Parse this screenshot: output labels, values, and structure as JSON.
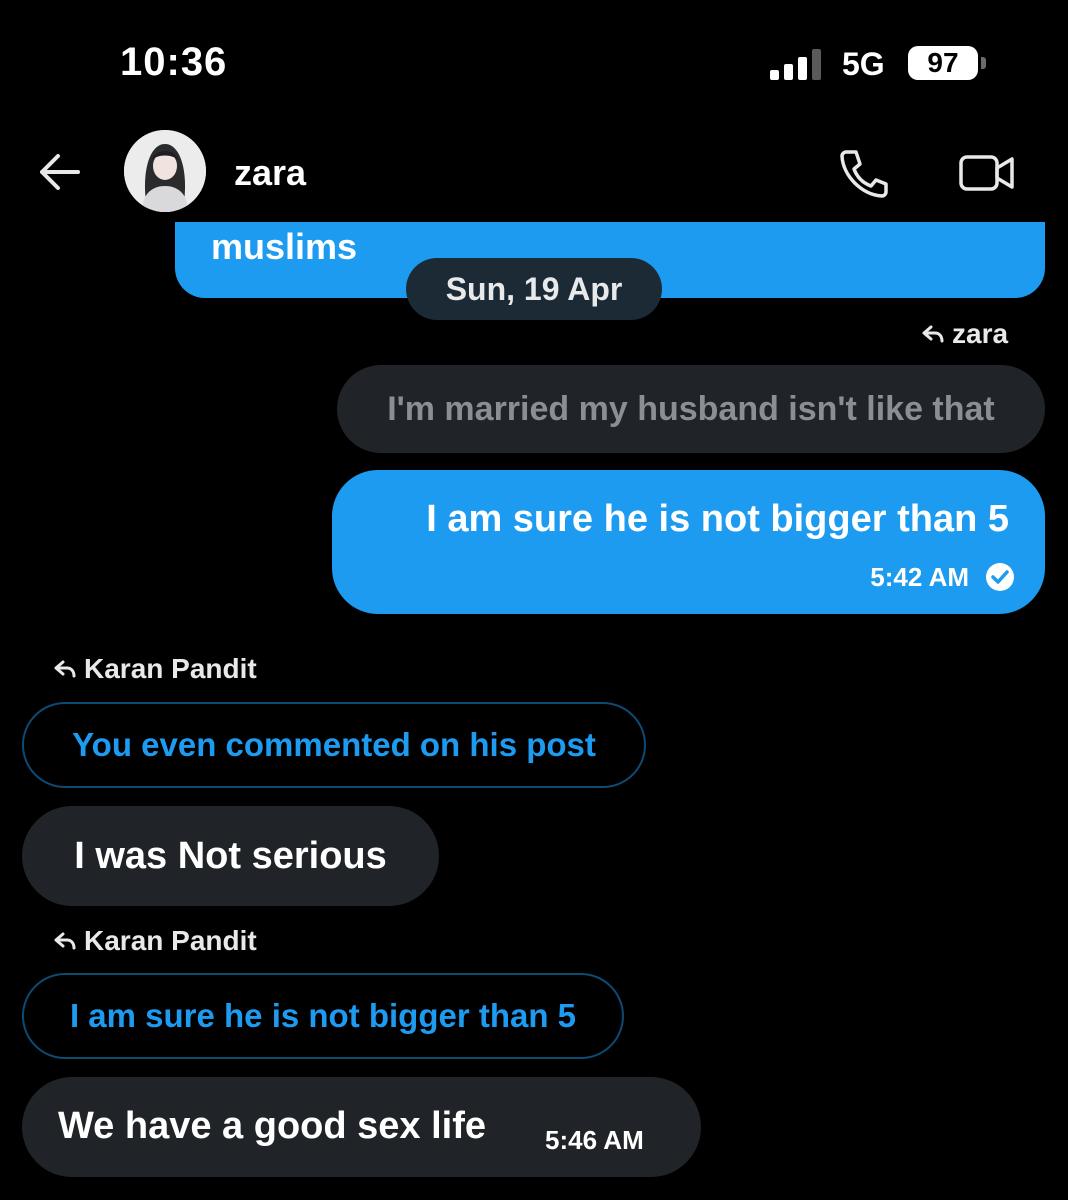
{
  "status_bar": {
    "time": "10:36",
    "network": "5G",
    "battery": "97"
  },
  "header": {
    "contact_name": "zara"
  },
  "messages": {
    "previous_partial": "muslims",
    "date_separator": "Sun, 19 Apr",
    "reply_to_zara": "zara",
    "quoted_from_zara": "I'm married my husband isn't like that",
    "sent_message": "I am sure he is not bigger than 5",
    "sent_time": "5:42 AM",
    "reply_to_karan_1": "Karan Pandit",
    "quoted_1": "You even commented on his post",
    "received_1": "I was Not serious",
    "reply_to_karan_2": "Karan Pandit",
    "quoted_2": "I am sure he is not bigger than 5",
    "received_2": "We have a good sex life",
    "received_2_time": "5:46 AM"
  },
  "icons": {
    "back": "arrow-left-icon",
    "phone": "phone-icon",
    "video": "video-camera-icon",
    "reply": "reply-arrow-icon",
    "read": "check-circle-icon"
  },
  "colors": {
    "accent": "#1d9bf0",
    "bubble_gray": "#202327",
    "background": "#000000"
  }
}
